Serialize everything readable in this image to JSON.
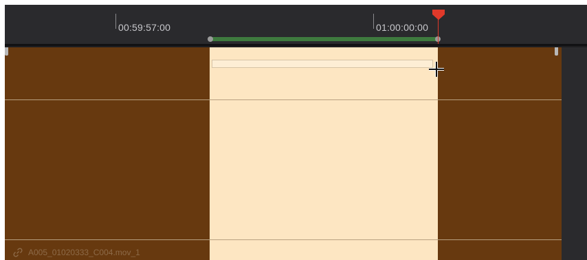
{
  "timeline": {
    "timecodes": [
      "00:59:57:00",
      "01:00:00:00"
    ],
    "clip_name": "A005_01020333_C004.mov_1"
  },
  "colors": {
    "clip": "#67390f",
    "selected_range": "#fde6c2",
    "in_out_bar": "#3e7a3e",
    "playhead": "#e0392a"
  },
  "icons": {
    "clip_link": "link-icon",
    "cursor": "trim-cursor-icon",
    "playhead": "playhead-marker-icon"
  }
}
